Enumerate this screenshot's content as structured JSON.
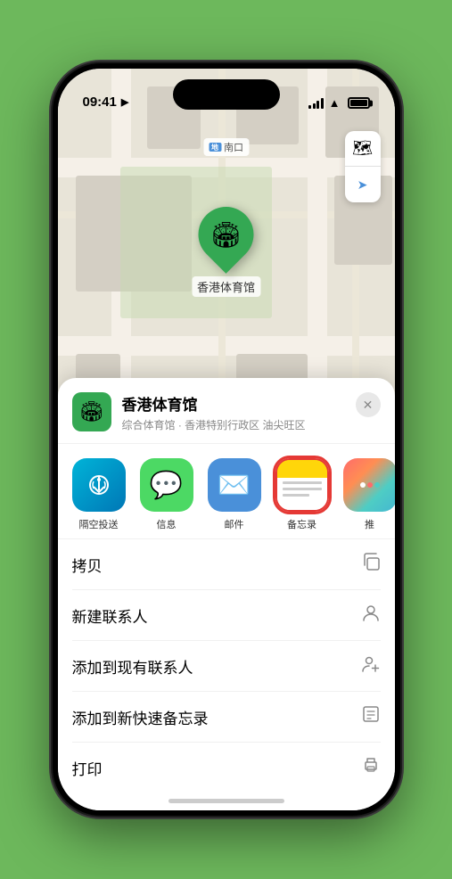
{
  "status_bar": {
    "time": "09:41",
    "location_arrow": "▶"
  },
  "map": {
    "label_nk": "南口",
    "pin_emoji": "🏟",
    "pin_label": "香港体育馆",
    "controls": {
      "map_icon": "🗺",
      "location_icon": "➤"
    }
  },
  "venue": {
    "icon_emoji": "🏟",
    "name": "香港体育馆",
    "subtitle": "综合体育馆 · 香港特别行政区 油尖旺区",
    "close_label": "✕"
  },
  "share_items": [
    {
      "id": "airdrop",
      "label": "隔空投送",
      "type": "airdrop"
    },
    {
      "id": "messages",
      "label": "信息",
      "type": "messages",
      "emoji": "💬"
    },
    {
      "id": "mail",
      "label": "邮件",
      "type": "mail",
      "emoji": "✉️"
    },
    {
      "id": "notes",
      "label": "备忘录",
      "type": "notes",
      "selected": true
    },
    {
      "id": "more",
      "label": "推",
      "type": "more"
    }
  ],
  "actions": [
    {
      "label": "拷贝",
      "icon": "copy"
    },
    {
      "label": "新建联系人",
      "icon": "person"
    },
    {
      "label": "添加到现有联系人",
      "icon": "person-add"
    },
    {
      "label": "添加到新快速备忘录",
      "icon": "note"
    },
    {
      "label": "打印",
      "icon": "print"
    }
  ]
}
